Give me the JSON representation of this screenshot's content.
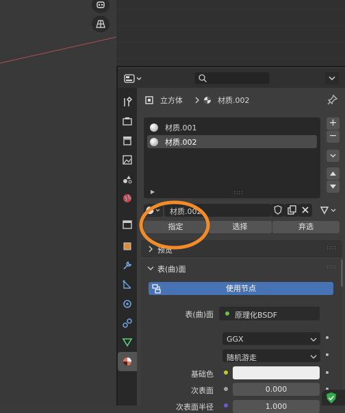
{
  "breadcrumb": {
    "object": "立方体",
    "material": "材质.002"
  },
  "slots": [
    {
      "label": "材质.001"
    },
    {
      "label": "材质.002"
    }
  ],
  "material_selector": {
    "name": "材质.002"
  },
  "slot_actions": {
    "assign": "指定",
    "select": "选择",
    "deselect": "弃选"
  },
  "panels": {
    "preview": "预览",
    "surface": "表(曲)面"
  },
  "use_nodes_label": "使用节点",
  "surface_row": {
    "label": "表(曲)面",
    "value": "原理化BSDF"
  },
  "dropdowns": {
    "distribution": "GGX",
    "subsurface_method": "随机游走"
  },
  "props": [
    {
      "label": "基础色",
      "value": ""
    },
    {
      "label": "次表面",
      "value": "0.000"
    },
    {
      "label": "次表面半径",
      "value": "1.000"
    }
  ],
  "colors": {
    "highlight": "#f28c28",
    "use_nodes_bg": "#4772b3",
    "accent_green": "#6fbf4f"
  }
}
